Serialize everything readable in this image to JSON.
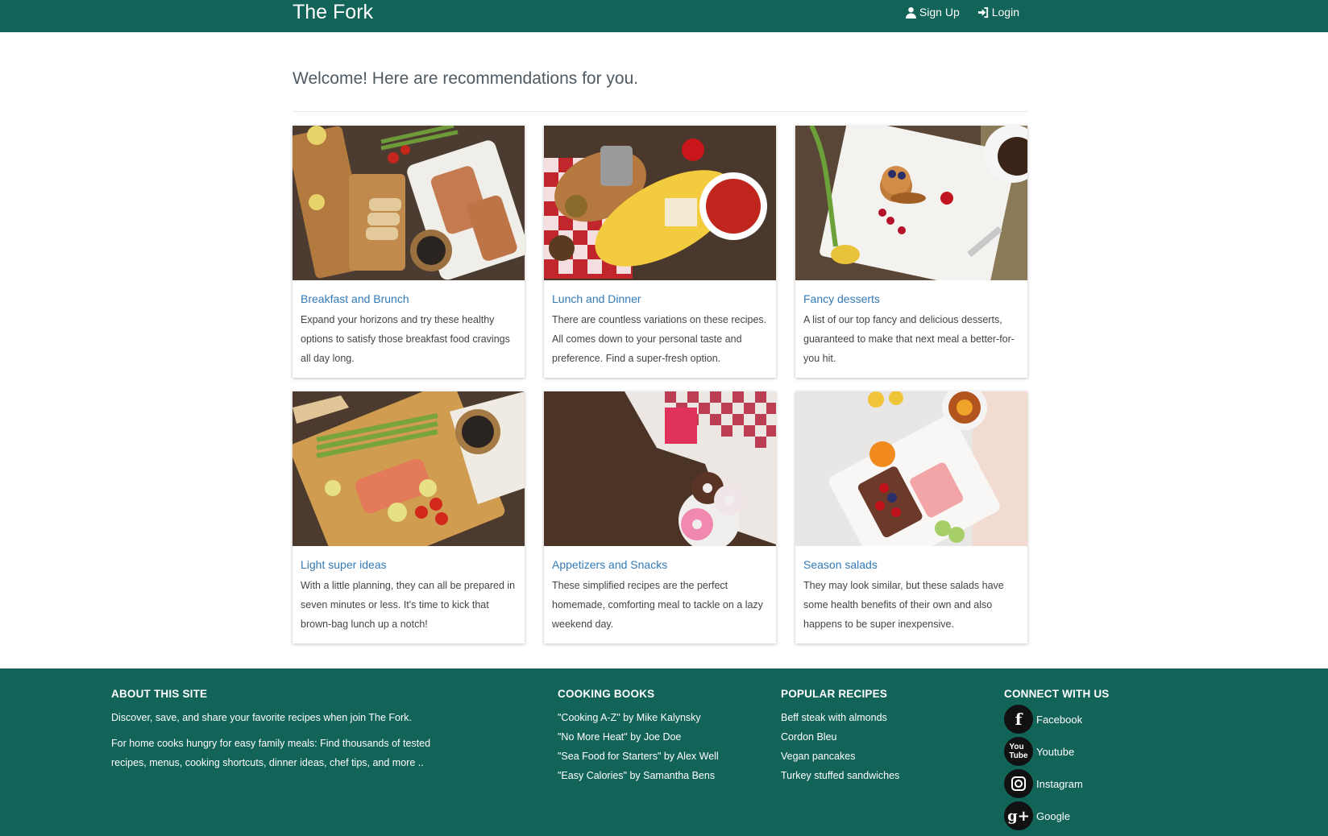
{
  "nav": {
    "brand": "The Fork",
    "signup_label": "Sign Up",
    "login_label": "Login"
  },
  "main": {
    "welcome": "Welcome! Here are recommendations for you."
  },
  "cards": [
    {
      "title": "Breakfast and Brunch",
      "text": "Expand your horizons and try these healthy options to satisfy those breakfast food cravings all day long."
    },
    {
      "title": "Lunch and Dinner",
      "text": "There are countless variations on these recipes. All comes down to your personal taste and preference. Find a super-fresh option."
    },
    {
      "title": "Fancy desserts",
      "text": "A list of our top fancy and delicious desserts, guaranteed to make that next meal a better-for-you hit."
    },
    {
      "title": "Light super ideas",
      "text": "With a little planning, they can all be prepared in seven minutes or less. It's time to kick that brown-bag lunch up a notch!"
    },
    {
      "title": "Appetizers and Snacks",
      "text": "These simplified recipes are the perfect homemade, comforting meal to tackle on a lazy weekend day."
    },
    {
      "title": "Season salads",
      "text": "They may look similar, but these salads have some health benefits of their own and also happens to be super inexpensive."
    }
  ],
  "footer": {
    "about": {
      "heading": "ABOUT THIS SITE",
      "p1": "Discover, save, and share your favorite recipes when join The Fork.",
      "p2": "For home cooks hungry for easy family meals: Find thousands of tested recipes, menus, cooking shortcuts, dinner ideas, chef tips, and more .."
    },
    "books": {
      "heading": "COOKING BOOKS",
      "items": [
        "\"Cooking A-Z\" by Mike Kalynsky",
        "\"No More Heat\" by Joe Doe",
        "\"Sea Food for Starters\" by Alex Well",
        "\"Easy Calories\" by Samantha Bens"
      ]
    },
    "popular": {
      "heading": "POPULAR RECIPES",
      "items": [
        "Beff steak with almonds",
        "Cordon Bleu",
        "Vegan pancakes",
        "Turkey stuffed sandwiches"
      ]
    },
    "connect": {
      "heading": "CONNECT WITH US",
      "items": [
        {
          "label": "Facebook",
          "icon": "facebook-icon"
        },
        {
          "label": "Youtube",
          "icon": "youtube-icon"
        },
        {
          "label": "Instagram",
          "icon": "instagram-icon"
        },
        {
          "label": "Google",
          "icon": "google-plus-icon"
        }
      ]
    }
  },
  "colors": {
    "brand_green": "#126358",
    "link_blue": "#337ab7"
  }
}
